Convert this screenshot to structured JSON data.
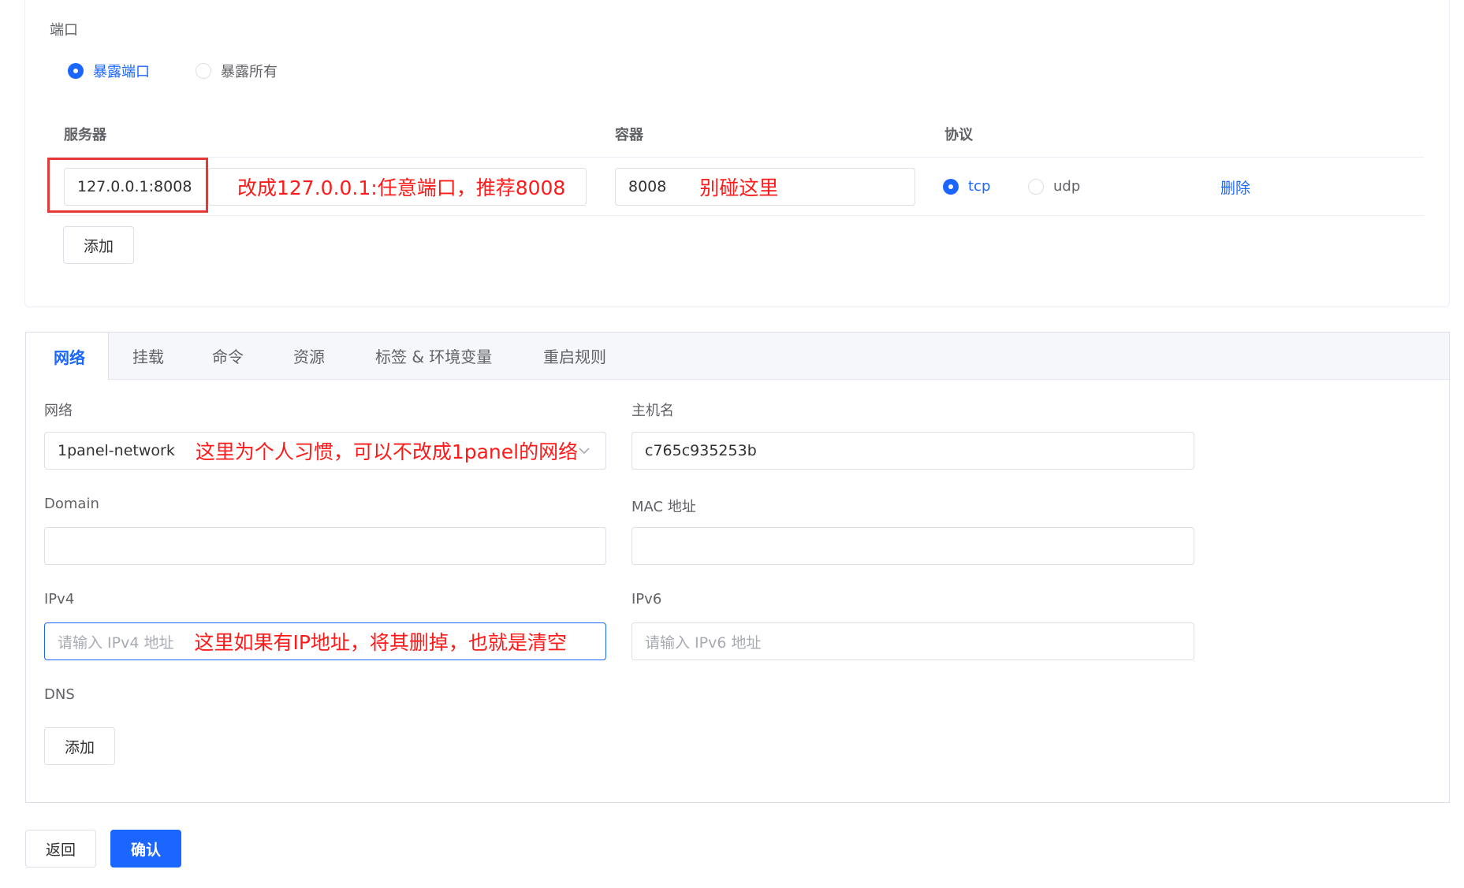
{
  "ports": {
    "label": "端口",
    "mode_options": [
      {
        "label": "暴露端口",
        "selected": true
      },
      {
        "label": "暴露所有",
        "selected": false
      }
    ],
    "columns": {
      "server": "服务器",
      "container": "容器",
      "protocol": "协议"
    },
    "row": {
      "server_value": "127.0.0.1:8008",
      "server_note": "改成127.0.0.1:任意端口，推荐8008",
      "container_value": "8008",
      "container_note": "别碰这里",
      "protocols": [
        {
          "label": "tcp",
          "selected": true
        },
        {
          "label": "udp",
          "selected": false
        }
      ],
      "delete_label": "删除"
    },
    "add_label": "添加"
  },
  "tabs": [
    {
      "label": "网络",
      "active": true
    },
    {
      "label": "挂载",
      "active": false
    },
    {
      "label": "命令",
      "active": false
    },
    {
      "label": "资源",
      "active": false
    },
    {
      "label": "标签 & 环境变量",
      "active": false
    },
    {
      "label": "重启规则",
      "active": false
    }
  ],
  "network": {
    "network_label": "网络",
    "network_value": "1panel-network",
    "network_note": "这里为个人习惯，可以不改成1panel的网络",
    "hostname_label": "主机名",
    "hostname_value": "c765c935253b",
    "domain_label": "Domain",
    "domain_value": "",
    "mac_label": "MAC 地址",
    "mac_value": "",
    "ipv4_label": "IPv4",
    "ipv4_placeholder": "请输入 IPv4 地址",
    "ipv4_note": "这里如果有IP地址，将其删掉，也就是清空",
    "ipv6_label": "IPv6",
    "ipv6_placeholder": "请输入 IPv6 地址",
    "dns_label": "DNS",
    "dns_add_label": "添加"
  },
  "footer": {
    "back_label": "返回",
    "confirm_label": "确认"
  },
  "colors": {
    "accent": "#1a66ff",
    "annotation": "#ff1a1a",
    "highlight_box": "#e53935"
  }
}
